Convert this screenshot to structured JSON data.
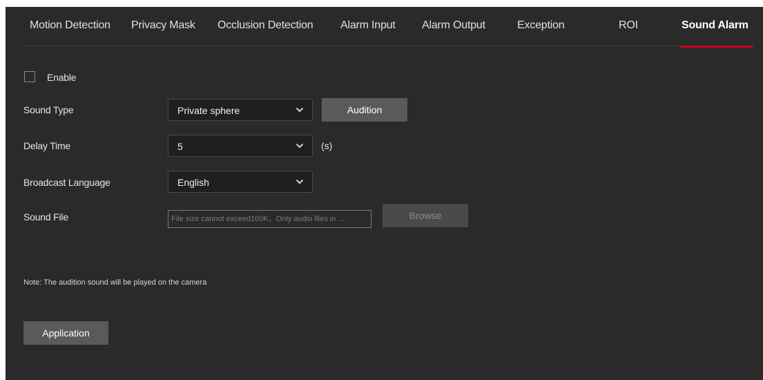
{
  "tabs": [
    {
      "label": "Motion Detection",
      "active": false
    },
    {
      "label": "Privacy Mask",
      "active": false
    },
    {
      "label": "Occlusion Detection",
      "active": false
    },
    {
      "label": "Alarm Input",
      "active": false
    },
    {
      "label": "Alarm Output",
      "active": false
    },
    {
      "label": "Exception",
      "active": false
    },
    {
      "label": "ROI",
      "active": false
    },
    {
      "label": "Sound Alarm",
      "active": true
    }
  ],
  "form": {
    "enable": {
      "label": "Enable",
      "checked": false
    },
    "sound_type": {
      "label": "Sound Type",
      "value": "Private sphere",
      "audition_label": "Audition"
    },
    "delay_time": {
      "label": "Delay Time",
      "value": "5",
      "unit": "(s)"
    },
    "broadcast_language": {
      "label": "Broadcast Language",
      "value": "English"
    },
    "sound_file": {
      "label": "Sound File",
      "placeholder": "File size cannot exceed100K，Only audio files in ...",
      "browse_label": "Browse"
    }
  },
  "note": "Note: The audition sound will be played on the camera",
  "apply_label": "Application",
  "colors": {
    "panel_bg": "#2a2a2a",
    "accent": "#d0021b",
    "button_bg": "#5a5a5a"
  },
  "icons": {
    "dropdown": "chevron-down-icon"
  }
}
